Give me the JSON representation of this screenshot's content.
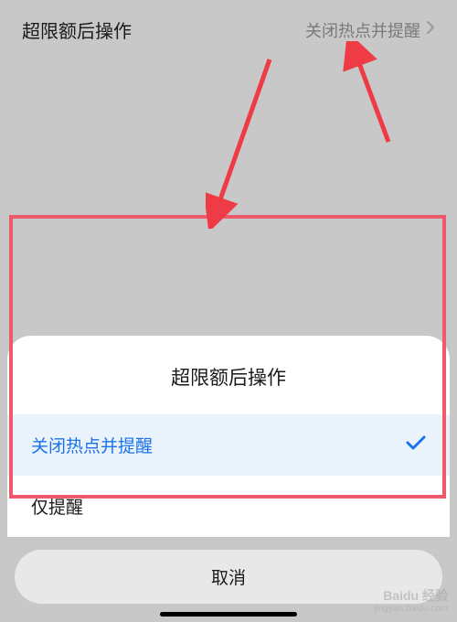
{
  "settings_row": {
    "label": "超限额后操作",
    "value": "关闭热点并提醒"
  },
  "action_sheet": {
    "title": "超限额后操作",
    "options": [
      {
        "label": "关闭热点并提醒",
        "selected": true
      },
      {
        "label": "仅提醒",
        "selected": false
      }
    ],
    "cancel": "取消"
  },
  "annotation": {
    "highlight_color": "#ef5a6b",
    "arrow_color": "#ee3b46"
  },
  "watermark": {
    "brand": "Baidu 经验",
    "url": "jingyan.baidu.com"
  }
}
